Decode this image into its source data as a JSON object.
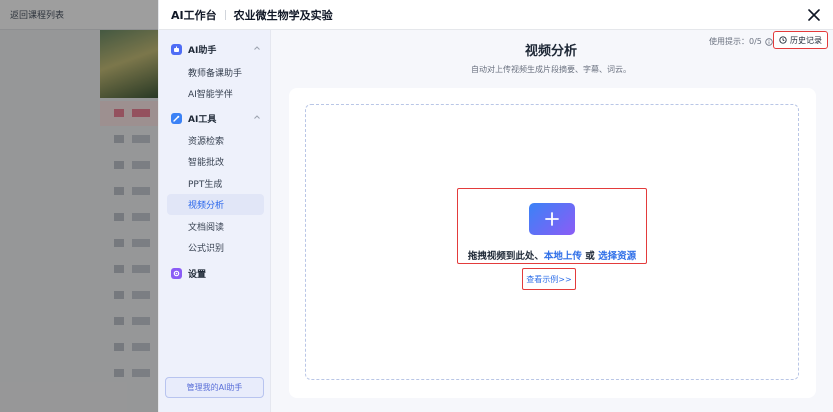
{
  "background": {
    "back_text": "返回课程列表"
  },
  "modal": {
    "title": "AI工作台",
    "course": "农业微生物学及实验"
  },
  "sidebar": {
    "groups": [
      {
        "label": "AI助手",
        "icon": "robot-icon",
        "color": "#4f6df5",
        "items": [
          {
            "label": "教师备课助手",
            "active": false
          },
          {
            "label": "AI智能学伴",
            "active": false
          }
        ]
      },
      {
        "label": "AI工具",
        "icon": "tool-icon",
        "color": "#3b82f6",
        "items": [
          {
            "label": "资源检索",
            "active": false
          },
          {
            "label": "智能批改",
            "active": false
          },
          {
            "label": "PPT生成",
            "active": false
          },
          {
            "label": "视频分析",
            "active": true
          },
          {
            "label": "文档阅读",
            "active": false
          },
          {
            "label": "公式识别",
            "active": false
          }
        ]
      },
      {
        "label": "设置",
        "icon": "settings-icon",
        "color": "#8b5cf6",
        "items": []
      }
    ],
    "manage_button": "管理我的AI助手"
  },
  "main": {
    "usage_label": "使用提示：0/5",
    "history_button": "历史记录",
    "title": "视频分析",
    "subtitle": "自动对上传视频生成片段摘要、字幕、词云。",
    "upload": {
      "prefix": "拖拽视频到此处、",
      "local_upload": "本地上传",
      "or": " 或 ",
      "choose_resource": "选择资源"
    },
    "example_link": "查看示例>>"
  },
  "colors": {
    "accent": "#2f6fe8",
    "highlight_border": "#e33b3b",
    "gradient_start": "#3b82f6",
    "gradient_end": "#8b5cf6"
  }
}
